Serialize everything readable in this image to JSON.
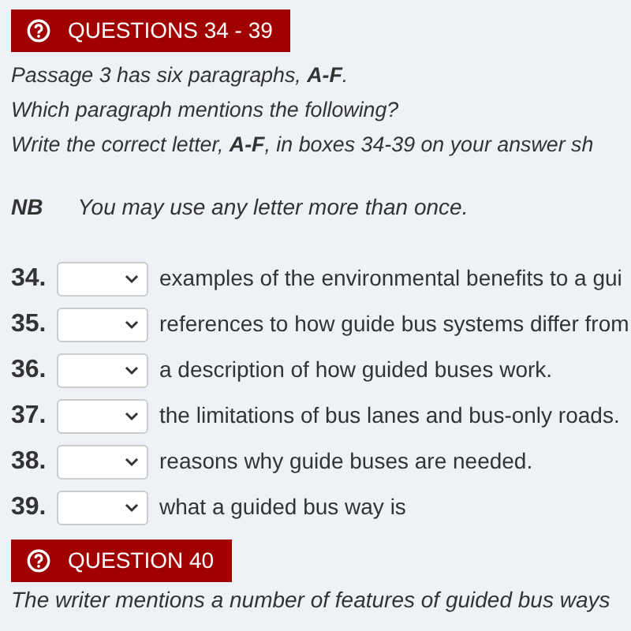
{
  "sections": [
    {
      "heading": "QUESTIONS 34 - 39",
      "instructions": [
        "Passage 3 has six paragraphs, **A-F**.",
        "Which paragraph mentions the following?",
        "Write the correct letter, **A-F**, in boxes 34-39 on your answer sh"
      ],
      "note": {
        "label": "NB",
        "text": "You may use any letter more than once."
      },
      "questions": [
        {
          "number": "34.",
          "text": "examples of the environmental benefits to a gui"
        },
        {
          "number": "35.",
          "text": "references to how guide bus systems differ from"
        },
        {
          "number": "36.",
          "text": "a description of how guided buses work."
        },
        {
          "number": "37.",
          "text": "the limitations of bus lanes and bus-only roads."
        },
        {
          "number": "38.",
          "text": "reasons why guide buses are needed."
        },
        {
          "number": "39.",
          "text": "what a guided bus way is"
        }
      ]
    },
    {
      "heading": "QUESTION 40",
      "instructions": [
        "The writer mentions a number of features of guided bus ways"
      ]
    }
  ]
}
